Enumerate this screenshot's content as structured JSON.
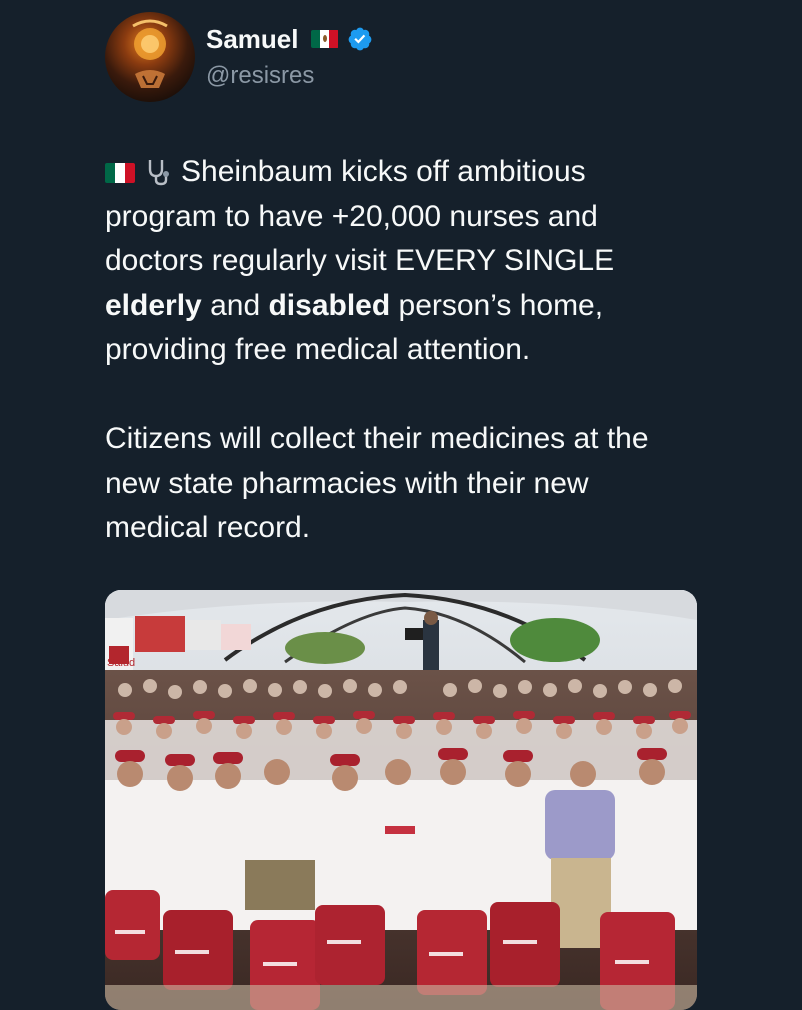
{
  "account": {
    "display_name": "Samuel",
    "handle": "@resisres",
    "country_flag_icon": "mexico-flag-icon",
    "verified_icon": "verified-badge-icon",
    "verified_color": "#1d9bf0"
  },
  "tweet": {
    "lead_icons": [
      "mexico-flag-icon",
      "stethoscope-icon"
    ],
    "p1_a": "Sheinbaum kicks off ambitious program to have +20,000 nurses and doctors regularly visit EVERY SINGLE ",
    "p1_b": "elderly",
    "p1_c": " and ",
    "p1_d": "disabled",
    "p1_e": " person’s home, providing free medical attention.",
    "p2": "Citizens will collect their medicines at the new state pharmacies with their new medical record."
  },
  "media": {
    "image_icon": "group-photo-image",
    "banner_text": "Salud"
  },
  "colors": {
    "background": "#15202b",
    "text": "#f7f9f9",
    "secondary_text": "#8b98a5"
  }
}
